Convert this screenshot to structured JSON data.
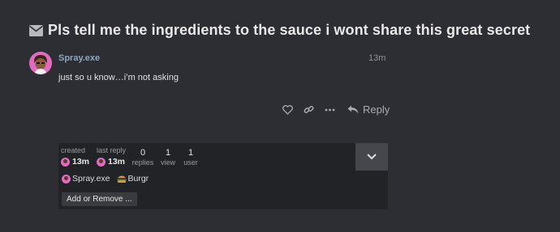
{
  "topic": {
    "title": "Pls tell me the ingredients to the sauce i wont share this great secret",
    "icon": "envelope-icon"
  },
  "post": {
    "username": "Spray.exe",
    "time": "13m",
    "body": "just so u know…i’m not asking",
    "actions": {
      "like_icon": "heart-icon",
      "link_icon": "link-icon",
      "more_icon": "ellipsis-icon",
      "reply_label": "Reply"
    }
  },
  "summary": {
    "created_label": "created",
    "created_time": "13m",
    "last_reply_label": "last reply",
    "last_reply_time": "13m",
    "stats": [
      {
        "num": "0",
        "label": "replies"
      },
      {
        "num": "1",
        "label": "view"
      },
      {
        "num": "1",
        "label": "user"
      }
    ],
    "participants": [
      {
        "name": "Spray.exe"
      },
      {
        "name": "Burgr"
      }
    ],
    "add_remove_label": "Add or Remove ..."
  },
  "colors": {
    "background": "#2d2e33",
    "username": "#8fa6be",
    "avatar": "#e06cc0"
  }
}
